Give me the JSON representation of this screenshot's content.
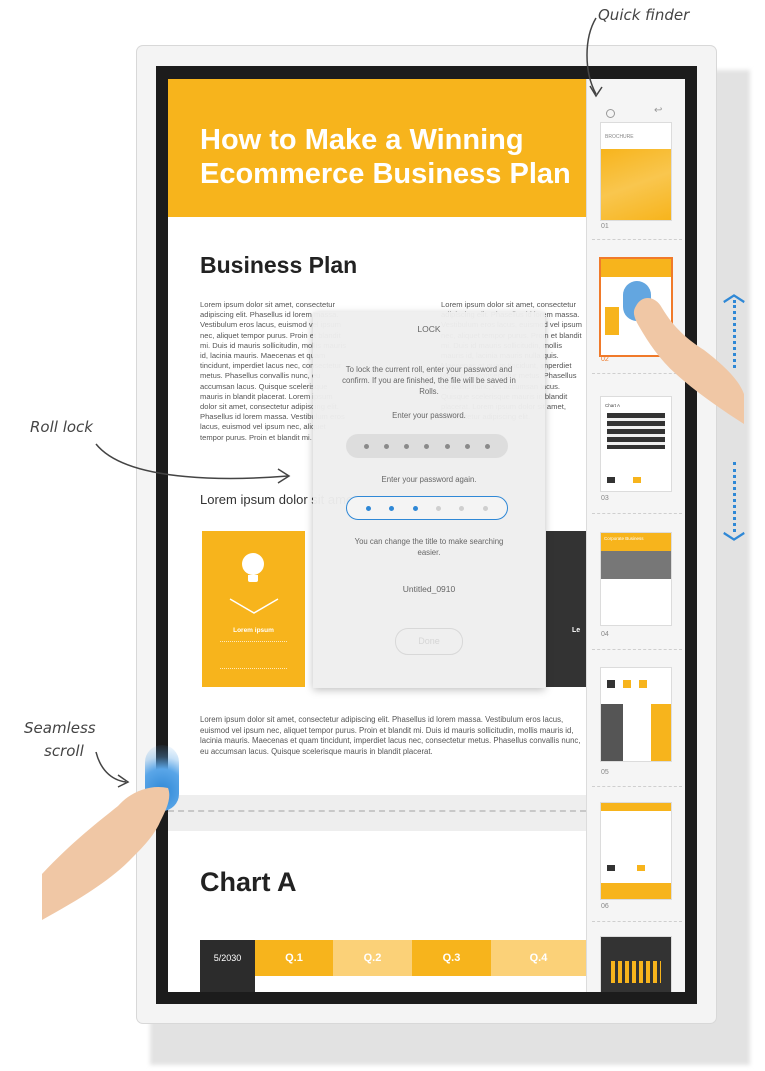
{
  "annotations": {
    "quick_finder": "Quick finder",
    "roll_lock": "Roll lock",
    "seamless_scroll_1": "Seamless",
    "seamless_scroll_2": "scroll"
  },
  "document": {
    "hero_title": "How to Make a Winning Ecommerce Business Plan",
    "section_title": "Business Plan",
    "col1_text": "Lorem ipsum dolor sit amet, consectetur adipiscing elit. Phasellus id lorem massa. Vestibulum eros lacus, euismod vel ipsum nec, aliquet tempor purus. Proin et blandit mi. Duis id mauris sollicitudin, mollis mauris id, lacinia mauris. Maecenas et quam tincidunt, imperdiet lacus nec, consectetur metus. Phasellus convallis nunc, eu accumsan lacus. Quisque scelerisque mauris in blandit placerat. Lorem ipsum dolor sit amet, consectetur adipiscing elit. Phasellus id lorem massa. Vestibulum eros lacus, euismod vel ipsum nec, aliquet tempor purus. Proin et blandit mi.",
    "col2_text": "Lorem ipsum dolor sit amet, consectetur adipiscing elit. Phasellus id lorem massa. Vestibulum eros lacus, euismod vel ipsum nec, aliquet tempor purus. Proin et blandit mi. Duis id mauris sollicitudin, mollis mauris id, lacinia mauris nulla quis. Maecenas et quam tincidunt, imperdiet lacus nec, consectetur metus. Phasellus convallis nunc, eu accumsan lacus. Quisque scelerisque mauris in blandit placerat. Lorem ipsum dolor sit amet, consectetur adipiscing elit.",
    "subheading": "Lorem ipsum dolor sit amet",
    "card_label": "Lorem ipsum",
    "card_right_label": "Le",
    "body_text": "Lorem ipsum dolor sit amet, consectetur adipiscing elit. Phasellus id lorem massa. Vestibulum eros lacus, euismod vel ipsum nec, aliquet tempor purus. Proin et blandit mi. Duis id mauris sollicitudin, mollis mauris id, lacinia mauris. Maecenas et quam tincidunt, imperdiet lacus nec, consectetur metus. Phasellus convallis nunc, eu accumsan lacus. Quisque scelerisque mauris in blandit placerat.",
    "chart_title": "Chart A",
    "table_headers": [
      "5/2030",
      "Q.1",
      "Q.2",
      "Q.3",
      "Q.4"
    ]
  },
  "dialog": {
    "title": "LOCK",
    "instructions": "To lock the current roll, enter your password and confirm. If you are finished, the file will be saved in Rolls.",
    "enter_pw": "Enter your password.",
    "enter_pw_again": "Enter your password again.",
    "change_title_hint": "You can change the title to make searching easier.",
    "file_title": "Untitled_0910",
    "done_button": "Done"
  },
  "finder": {
    "thumbnail_labels": [
      "01",
      "02",
      "03",
      "04",
      "05",
      "06"
    ],
    "thumb1_header": "BROCHURE",
    "thumb4_title": "Corporate Business",
    "thumb3_title": "Chart A"
  },
  "colors": {
    "accent": "#f7b41c",
    "annotation_blue": "#2f88d6",
    "dark": "#1c1c1c"
  }
}
